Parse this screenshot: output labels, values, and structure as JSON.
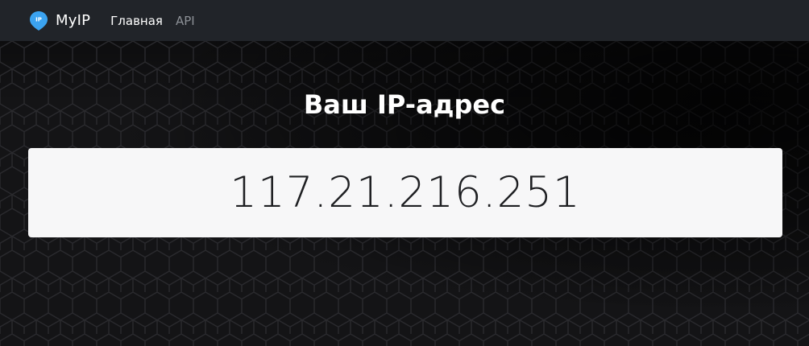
{
  "navbar": {
    "logo_icon": "ip-location-pin-icon",
    "logo_text": "IP",
    "brand": "MyIP",
    "links": [
      {
        "label": "Главная",
        "active": true
      },
      {
        "label": "API",
        "active": false
      }
    ]
  },
  "main": {
    "title": "Ваш IP-адрес",
    "ip_address": "117.21.216.251"
  },
  "colors": {
    "navbar_bg": "#212429",
    "accent": "#3ba3f0",
    "card_bg": "#f7f7f8"
  }
}
